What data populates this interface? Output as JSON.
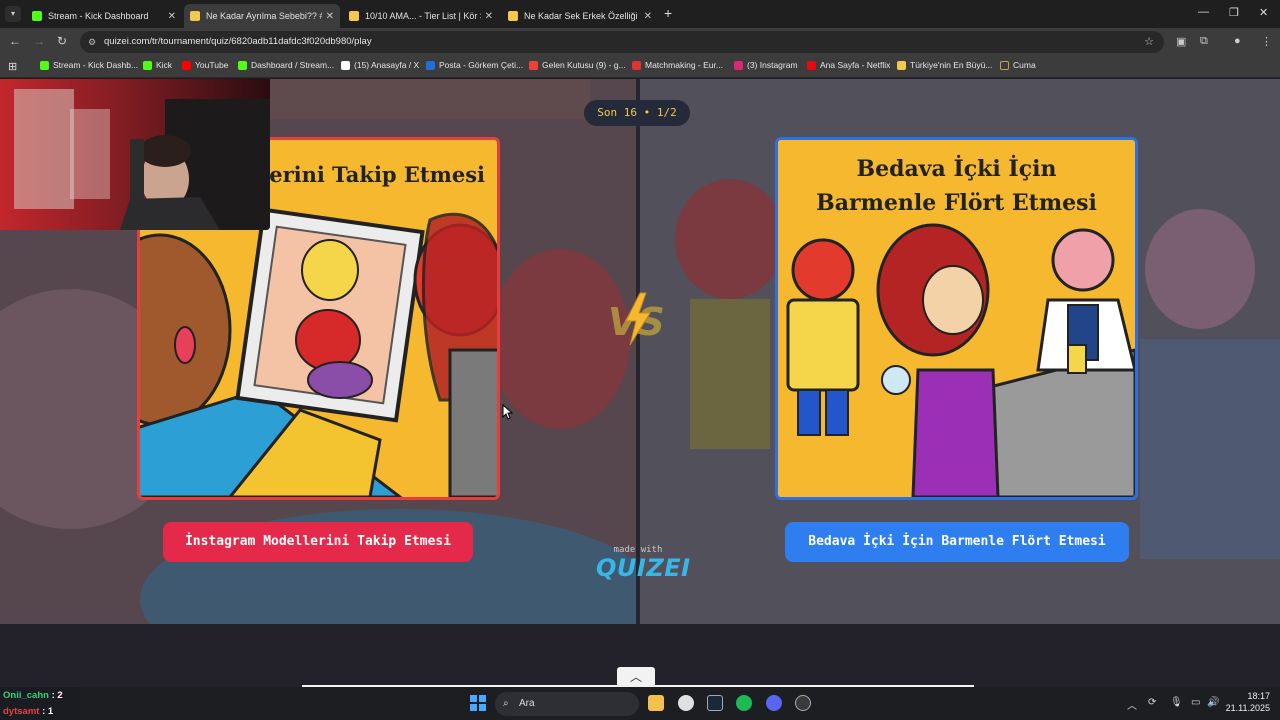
{
  "browser": {
    "tabs": [
      {
        "title": "Stream - Kick Dashboard",
        "active": false,
        "icon": "kick-icon",
        "color": "#53fc18"
      },
      {
        "title": "Ne Kadar Ayrılma Sebebi?? #1",
        "active": true,
        "icon": "quizei-icon",
        "color": "#f2c94c"
      },
      {
        "title": "10/10 AMA... - Tier List | Kör Sa",
        "active": false,
        "icon": "quizei-icon",
        "color": "#f2c94c"
      },
      {
        "title": "Ne Kadar Sek Erkek Özelliği #1",
        "active": false,
        "icon": "quizei-icon",
        "color": "#f2c94c"
      }
    ],
    "url": "quizei.com/tr/tournament/quiz/6820adb11dafdc3f020db980/play",
    "bookmarks": [
      {
        "label": "Stream - Kick Dashb...",
        "color": "#53fc18"
      },
      {
        "label": "Kick",
        "color": "#53fc18"
      },
      {
        "label": "YouTube",
        "color": "#ff0000"
      },
      {
        "label": "Dashboard / Stream...",
        "color": "#53fc18"
      },
      {
        "label": "(15) Anasayfa / X",
        "color": "#ffffff"
      },
      {
        "label": "Posta - Görkem Çeti...",
        "color": "#1f6fd6"
      },
      {
        "label": "Gelen Kutusu (9) - g...",
        "color": "#ea4335"
      },
      {
        "label": "Matchmaking - Eur...",
        "color": "#d33"
      },
      {
        "label": "(3) Instagram",
        "color": "#d62976"
      },
      {
        "label": "Ana Sayfa - Netflix",
        "color": "#e50914"
      },
      {
        "label": "Türkiye'nin En Büyü...",
        "color": "#f2c94c"
      },
      {
        "label": "Cuma",
        "color": "#c9a14a"
      }
    ]
  },
  "quiz": {
    "round_badge": "Son 16 • 1/2",
    "left": {
      "card_title": "llerini Takip Etmesi",
      "button_label": "İnstagram Modellerini Takip Etmesi",
      "accent": "#e5294a"
    },
    "right": {
      "card_title_line1": "Bedava İçki İçin",
      "card_title_line2": "Barmenle Flört Etmesi",
      "button_label": "Bedava İçki İçin Barmenle Flört Etmesi",
      "accent": "#2f7ef0"
    },
    "vs_label": "VS",
    "made_with": "made with",
    "brand": "QUIZEI"
  },
  "chat_overlay": [
    {
      "user": "Onii_cahn",
      "count": ": 2",
      "color": "#3ad07a"
    },
    {
      "user": "dytsamt",
      "count": ": 1",
      "color": "#e04545"
    }
  ],
  "taskbar": {
    "search_placeholder": "Ara",
    "time": "18:17",
    "date": "21.11.2025"
  }
}
